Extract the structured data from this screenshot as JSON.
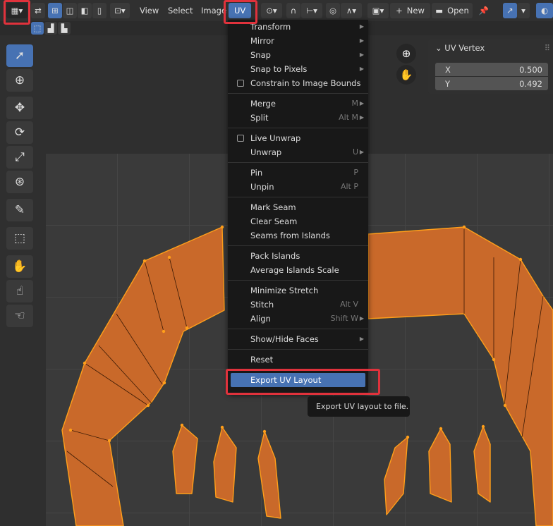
{
  "header": {
    "menus": [
      "View",
      "Select",
      "Image",
      "UV"
    ],
    "new_label": "New",
    "open_label": "Open"
  },
  "uv_menu": {
    "items": [
      {
        "label": "Transform",
        "submenu": true
      },
      {
        "label": "Mirror",
        "submenu": true
      },
      {
        "label": "Snap",
        "submenu": true
      },
      {
        "label": "Snap to Pixels",
        "submenu": true
      },
      {
        "label": "Constrain to Image Bounds",
        "checkbox": true
      },
      {
        "label": "Merge",
        "shortcut": "M",
        "submenu": true,
        "sep": true
      },
      {
        "label": "Split",
        "shortcut": "Alt M",
        "submenu": true
      },
      {
        "label": "Live Unwrap",
        "checkbox": true,
        "sep": true
      },
      {
        "label": "Unwrap",
        "shortcut": "U",
        "submenu": true
      },
      {
        "label": "Pin",
        "shortcut": "P",
        "sep": true
      },
      {
        "label": "Unpin",
        "shortcut": "Alt P"
      },
      {
        "label": "Mark Seam",
        "sep": true
      },
      {
        "label": "Clear Seam"
      },
      {
        "label": "Seams from Islands"
      },
      {
        "label": "Pack Islands",
        "sep": true
      },
      {
        "label": "Average Islands Scale"
      },
      {
        "label": "Minimize Stretch",
        "sep": true
      },
      {
        "label": "Stitch",
        "shortcut": "Alt V"
      },
      {
        "label": "Align",
        "shortcut": "Shift W",
        "submenu": true
      },
      {
        "label": "Show/Hide Faces",
        "submenu": true,
        "sep": true
      },
      {
        "label": "Reset",
        "sep": true
      },
      {
        "label": "Export UV Layout",
        "sep": true,
        "highlighted": true
      }
    ],
    "tooltip": "Export UV layout to file."
  },
  "uv_vertex_panel": {
    "title": "UV Vertex",
    "x_label": "X",
    "x_value": "0.500",
    "y_label": "Y",
    "y_value": "0.492"
  },
  "colors": {
    "accent": "#4772b3",
    "uv_face": "#c9692a",
    "uv_edge": "#ff9f1a",
    "highlight_box": "#e0323c"
  }
}
